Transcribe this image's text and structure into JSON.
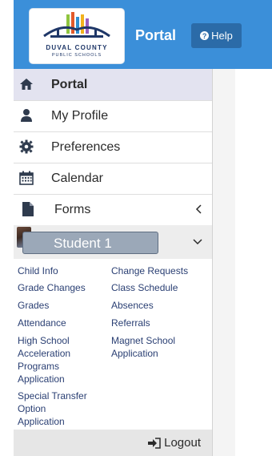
{
  "header": {
    "logo": {
      "name": "DUVAL COUNTY",
      "sub": "PUBLIC SCHOOLS"
    },
    "title": "Portal",
    "help_label": "Help"
  },
  "nav": [
    {
      "label": "Portal",
      "icon": "home-icon",
      "active": true
    },
    {
      "label": "My Profile",
      "icon": "user-icon"
    },
    {
      "label": "Preferences",
      "icon": "gear-icon"
    },
    {
      "label": "Calendar",
      "icon": "calendar-icon"
    },
    {
      "label": "Forms",
      "icon": "document-icon"
    }
  ],
  "student": {
    "name": "Student 1"
  },
  "links": {
    "child_info": "Child Info",
    "change_requests": "Change Requests",
    "grade_changes": "Grade Changes",
    "class_schedule": "Class Schedule",
    "grades": "Grades",
    "absences": "Absences",
    "attendance": "Attendance",
    "referrals": "Referrals",
    "hsap_1": "High School",
    "hsap_2": "Acceleration",
    "hsap_3": "Programs",
    "hsap_4": "Application",
    "magnet_1": "Magnet School",
    "magnet_2": "Application",
    "stoa_1": "Special Transfer",
    "stoa_2": "Option",
    "stoa_3": "Application"
  },
  "logout_label": "Logout",
  "colors": {
    "header": "#3b8fd9",
    "help": "#2b6ba8",
    "link": "#2a3f73",
    "active": "#e3e3f0"
  }
}
